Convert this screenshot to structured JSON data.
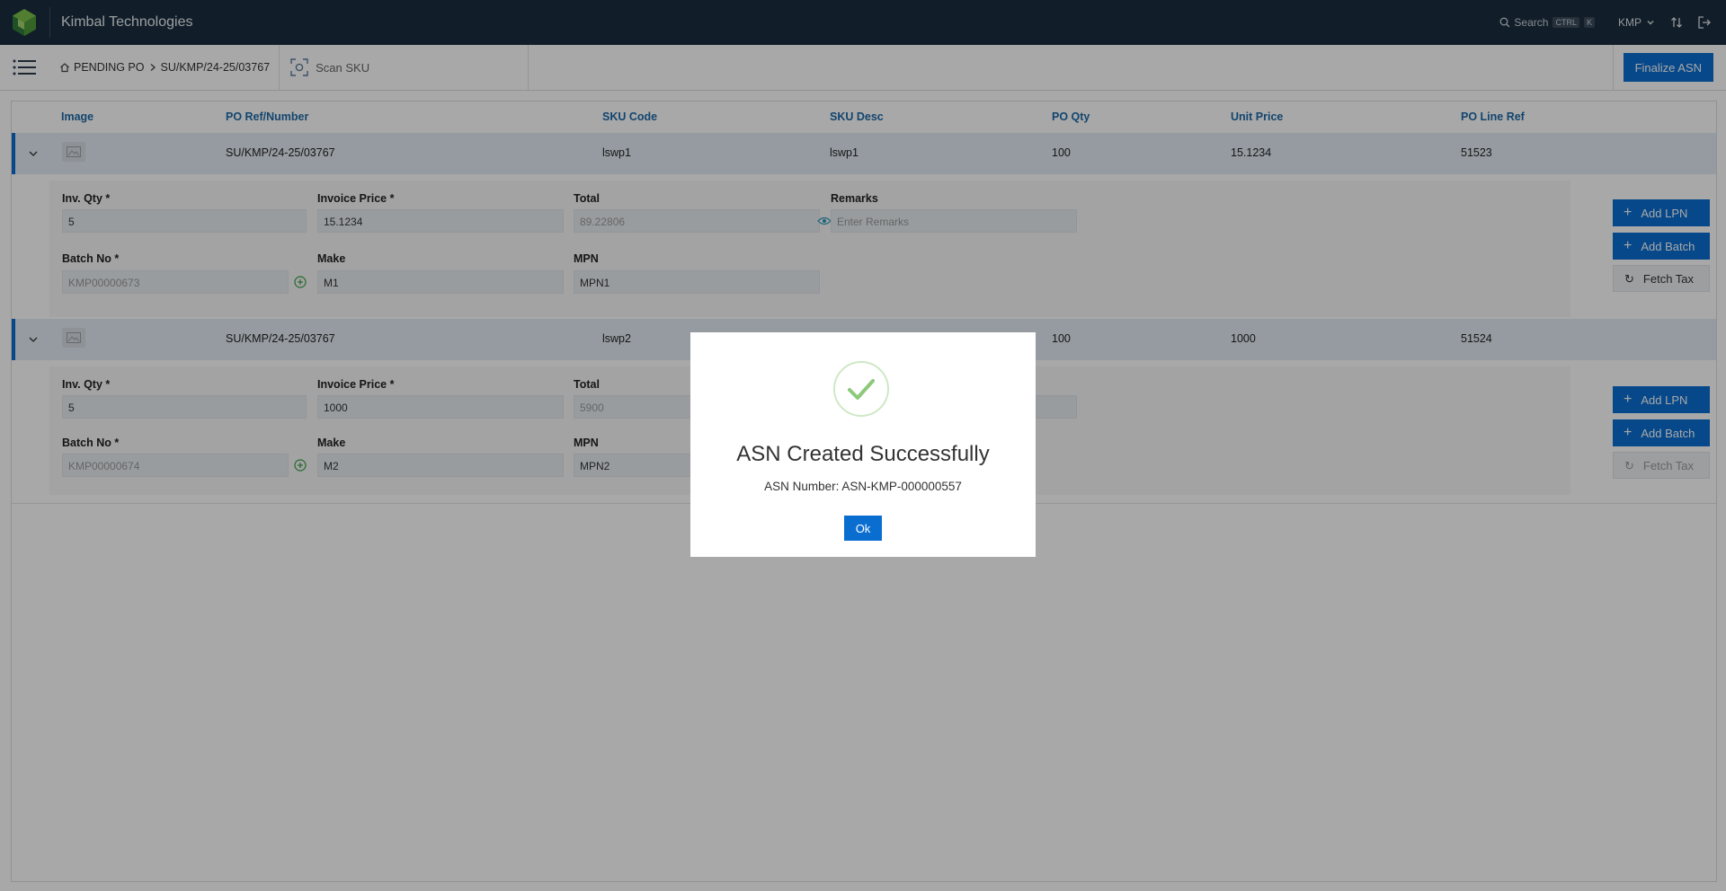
{
  "app": {
    "title": "Kimbal Technologies"
  },
  "topbar": {
    "search_label": "Search",
    "kbd1": "CTRL",
    "kbd2": "K",
    "org": "KMP"
  },
  "breadcrumb": {
    "home": "PENDING PO",
    "current": "SU/KMP/24-25/03767"
  },
  "toolbar": {
    "scan_label": "Scan SKU",
    "finalize_label": "Finalize ASN"
  },
  "table": {
    "columns": [
      "Image",
      "PO Ref/Number",
      "SKU Code",
      "SKU Desc",
      "PO Qty",
      "Unit Price",
      "PO Line Ref"
    ],
    "rows": [
      {
        "po_ref": "SU/KMP/24-25/03767",
        "sku_code": "lswp1",
        "sku_desc": "lswp1",
        "po_qty": "100",
        "unit_price": "15.1234",
        "po_line_ref": "51523",
        "inv_qty_label": "Inv. Qty *",
        "inv_qty": "5",
        "invoice_price_label": "Invoice Price *",
        "invoice_price": "15.1234",
        "total_label": "Total",
        "total": "89.22806",
        "remarks_label": "Remarks",
        "remarks_placeholder": "Enter Remarks",
        "batch_label": "Batch No *",
        "batch": "KMP00000673",
        "make_label": "Make",
        "make": "M1",
        "mpn_label": "MPN",
        "mpn": "MPN1",
        "add_lpn": "Add LPN",
        "add_batch": "Add Batch",
        "fetch_tax": "Fetch Tax"
      },
      {
        "po_ref": "SU/KMP/24-25/03767",
        "sku_code": "lswp2",
        "sku_desc": "lswp2",
        "po_qty": "100",
        "unit_price": "1000",
        "po_line_ref": "51524",
        "inv_qty_label": "Inv. Qty *",
        "inv_qty": "5",
        "invoice_price_label": "Invoice Price *",
        "invoice_price": "1000",
        "total_label": "Total",
        "total": "5900",
        "batch_label": "Batch No *",
        "batch": "KMP00000674",
        "make_label": "Make",
        "make": "M2",
        "mpn_label": "MPN",
        "mpn": "MPN2",
        "add_lpn": "Add LPN",
        "add_batch": "Add Batch",
        "fetch_tax": "Fetch Tax"
      }
    ]
  },
  "modal": {
    "title": "ASN Created Successfully",
    "message": "ASN Number: ASN-KMP-000000557",
    "ok_label": "Ok"
  },
  "colors": {
    "topbar": "#1b2d3e",
    "primary": "#0a6ed1",
    "header_text": "#1d6aa8",
    "success": "#8cc97a"
  }
}
